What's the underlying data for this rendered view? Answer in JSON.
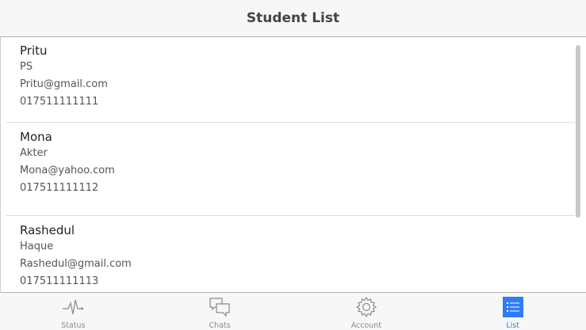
{
  "header": {
    "title": "Student List"
  },
  "students": [
    {
      "name": "Pritu",
      "surname": "PS",
      "email": "Pritu@gmail.com",
      "phone": "017511111111"
    },
    {
      "name": "Mona",
      "surname": "Akter",
      "email": "Mona@yahoo.com",
      "phone": "017511111112"
    },
    {
      "name": "Rashedul",
      "surname": "Haque",
      "email": "Rashedul@gmail.com",
      "phone": "017511111113"
    }
  ],
  "tabs": [
    {
      "label": "Status",
      "icon": "pulse-icon"
    },
    {
      "label": "Chats",
      "icon": "chat-bubbles-icon"
    },
    {
      "label": "Account",
      "icon": "gear-icon"
    },
    {
      "label": "List",
      "icon": "list-icon",
      "active": true
    }
  ],
  "colors": {
    "accent": "#2f7cf6",
    "header_bg": "#f7f7f7",
    "tab_inactive": "#8a8a8a"
  }
}
